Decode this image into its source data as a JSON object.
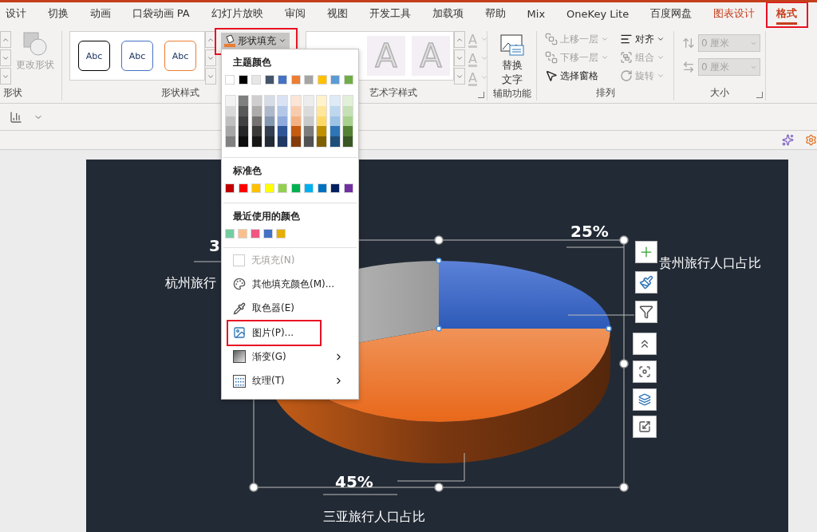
{
  "tabs": [
    {
      "label": "设计",
      "selected": false,
      "contextual": false,
      "highlighted": false
    },
    {
      "label": "切换",
      "selected": false,
      "contextual": false,
      "highlighted": false
    },
    {
      "label": "动画",
      "selected": false,
      "contextual": false,
      "highlighted": false
    },
    {
      "label": "口袋动画 PA",
      "selected": false,
      "contextual": false,
      "highlighted": false
    },
    {
      "label": "幻灯片放映",
      "selected": false,
      "contextual": false,
      "highlighted": false
    },
    {
      "label": "审阅",
      "selected": false,
      "contextual": false,
      "highlighted": false
    },
    {
      "label": "视图",
      "selected": false,
      "contextual": false,
      "highlighted": false
    },
    {
      "label": "开发工具",
      "selected": false,
      "contextual": false,
      "highlighted": false
    },
    {
      "label": "加载项",
      "selected": false,
      "contextual": false,
      "highlighted": false
    },
    {
      "label": "帮助",
      "selected": false,
      "contextual": false,
      "highlighted": false
    },
    {
      "label": "Mix",
      "selected": false,
      "contextual": false,
      "highlighted": false
    },
    {
      "label": "OneKey Lite",
      "selected": false,
      "contextual": false,
      "highlighted": false
    },
    {
      "label": "百度网盘",
      "selected": false,
      "contextual": false,
      "highlighted": false
    },
    {
      "label": "图表设计",
      "selected": false,
      "contextual": true,
      "highlighted": false
    },
    {
      "label": "格式",
      "selected": true,
      "contextual": true,
      "highlighted": true
    }
  ],
  "ribbon": {
    "shapes_group": {
      "label": "形状",
      "change_shape": {
        "label": "更改形状",
        "disabled": true
      }
    },
    "shape_styles_group": {
      "label": "形状样式",
      "styles": [
        {
          "label": "Abc",
          "color": "#000000"
        },
        {
          "label": "Abc",
          "color": "#4472c4"
        },
        {
          "label": "Abc",
          "color": "#ed7d31"
        }
      ],
      "shape_fill": {
        "label": "形状填充",
        "pressed": true,
        "highlighted": true
      }
    },
    "wordart_group": {
      "label": "艺术字样式",
      "samples": [
        "A",
        "A"
      ],
      "text_tools": [
        "A",
        "A",
        "A"
      ]
    },
    "accessibility_group": {
      "label": "辅助功能",
      "alt_text": "替换文字"
    },
    "arrange_group": {
      "label": "排列",
      "columns": [
        {
          "items": [
            {
              "label": "上移一层",
              "kind": "forward",
              "disabled": true,
              "dropdown": true
            },
            {
              "label": "下移一层",
              "kind": "backward",
              "disabled": true,
              "dropdown": true
            },
            {
              "label": "选择窗格",
              "kind": "pane",
              "disabled": false,
              "dropdown": false
            }
          ]
        },
        {
          "items": [
            {
              "label": "对齐",
              "kind": "align",
              "disabled": false,
              "dropdown": true
            },
            {
              "label": "组合",
              "kind": "group",
              "disabled": true,
              "dropdown": true
            },
            {
              "label": "旋转",
              "kind": "rotate",
              "disabled": true,
              "dropdown": true
            }
          ]
        }
      ]
    },
    "size_group": {
      "label": "大小",
      "height": "0 厘米",
      "width": "0 厘米",
      "disabled": true
    }
  },
  "fill_menu": {
    "theme_title": "主题颜色",
    "theme_colors": [
      {
        "color": "#ffffff",
        "shades": [
          {
            "color": "#f2f2f2"
          },
          {
            "color": "#d9d9d9"
          },
          {
            "color": "#bfbfbf"
          },
          {
            "color": "#a6a6a6"
          },
          {
            "color": "#808080"
          }
        ]
      },
      {
        "color": "#000000",
        "shades": [
          {
            "color": "#7f7f7f"
          },
          {
            "color": "#595959"
          },
          {
            "color": "#404040"
          },
          {
            "color": "#262626"
          },
          {
            "color": "#0d0d0d"
          }
        ]
      },
      {
        "color": "#e7e6e6",
        "shades": [
          {
            "color": "#d0cece"
          },
          {
            "color": "#aeabab"
          },
          {
            "color": "#757171"
          },
          {
            "color": "#3b3838"
          },
          {
            "color": "#171616"
          }
        ]
      },
      {
        "color": "#44546a",
        "shades": [
          {
            "color": "#d6dce5"
          },
          {
            "color": "#adb9ca"
          },
          {
            "color": "#8497b0"
          },
          {
            "color": "#333f50"
          },
          {
            "color": "#222a35"
          }
        ]
      },
      {
        "color": "#4472c4",
        "shades": [
          {
            "color": "#dae3f3"
          },
          {
            "color": "#b4c7e7"
          },
          {
            "color": "#8faadc"
          },
          {
            "color": "#2f5597"
          },
          {
            "color": "#203864"
          }
        ]
      },
      {
        "color": "#ed7d31",
        "shades": [
          {
            "color": "#fbe5d6"
          },
          {
            "color": "#f8cbad"
          },
          {
            "color": "#f4b183"
          },
          {
            "color": "#c55a11"
          },
          {
            "color": "#843c0c"
          }
        ]
      },
      {
        "color": "#a5a5a5",
        "shades": [
          {
            "color": "#ededed"
          },
          {
            "color": "#dbdbdb"
          },
          {
            "color": "#c9c9c9"
          },
          {
            "color": "#7b7b7b"
          },
          {
            "color": "#525252"
          }
        ]
      },
      {
        "color": "#ffc000",
        "shades": [
          {
            "color": "#fff2cc"
          },
          {
            "color": "#ffe699"
          },
          {
            "color": "#ffd966"
          },
          {
            "color": "#bf9000"
          },
          {
            "color": "#7f6000"
          }
        ]
      },
      {
        "color": "#5b9bd5",
        "shades": [
          {
            "color": "#deebf7"
          },
          {
            "color": "#bdd7ee"
          },
          {
            "color": "#9dc3e6"
          },
          {
            "color": "#2e75b6"
          },
          {
            "color": "#1f4e79"
          }
        ]
      },
      {
        "color": "#70ad47",
        "shades": [
          {
            "color": "#e2f0d9"
          },
          {
            "color": "#c5e0b4"
          },
          {
            "color": "#a9d18e"
          },
          {
            "color": "#548235"
          },
          {
            "color": "#385723"
          }
        ]
      }
    ],
    "standard_title": "标准色",
    "standard_colors": [
      {
        "color": "#c00000"
      },
      {
        "color": "#ff0000"
      },
      {
        "color": "#ffc000"
      },
      {
        "color": "#ffff00"
      },
      {
        "color": "#92d050"
      },
      {
        "color": "#00b050"
      },
      {
        "color": "#00b0f0"
      },
      {
        "color": "#0070c0"
      },
      {
        "color": "#002060"
      },
      {
        "color": "#7030a0"
      }
    ],
    "recent_title": "最近使用的颜色",
    "recent_colors": [
      {
        "color": "#74cda0"
      },
      {
        "color": "#fbbf8c"
      },
      {
        "color": "#ef5682"
      },
      {
        "color": "#4472c4"
      },
      {
        "color": "#e6ae00"
      }
    ],
    "items": [
      {
        "label": "无填充(N)",
        "kind": "none",
        "disabled": true,
        "submenu": false,
        "highlighted": false
      },
      {
        "label": "其他填充颜色(M)...",
        "kind": "palette",
        "disabled": false,
        "submenu": false,
        "highlighted": false
      },
      {
        "label": "取色器(E)",
        "kind": "eyedropper",
        "disabled": false,
        "submenu": false,
        "highlighted": false
      },
      {
        "label": "图片(P)...",
        "kind": "picture",
        "disabled": false,
        "submenu": false,
        "highlighted": true
      },
      {
        "label": "渐变(G)",
        "kind": "gradient",
        "disabled": false,
        "submenu": true,
        "highlighted": false
      },
      {
        "label": "纹理(T)",
        "kind": "texture",
        "disabled": false,
        "submenu": true,
        "highlighted": false
      }
    ]
  },
  "chart": {
    "labels": [
      {
        "value": "3",
        "name": "杭州旅行"
      },
      {
        "value": "25%",
        "name": "贵州旅行人口占比"
      },
      {
        "value": "45%",
        "name": "三亚旅行人口占比"
      }
    ]
  }
}
